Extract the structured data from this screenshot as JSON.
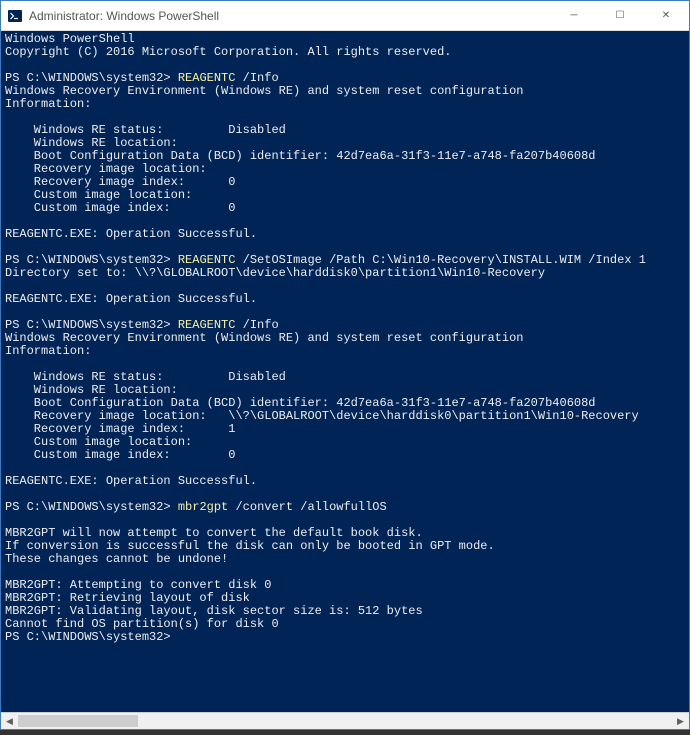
{
  "titlebar": {
    "title": "Administrator: Windows PowerShell",
    "icon_name": "powershell-icon"
  },
  "controls": {
    "minimize": "─",
    "maximize": "☐",
    "close": "✕"
  },
  "terminal": {
    "header1": "Windows PowerShell",
    "header2": "Copyright (C) 2016 Microsoft Corporation. All rights reserved.",
    "prompt": "PS C:\\WINDOWS\\system32>",
    "cmd1_exe": "REAGENTC",
    "cmd1_args": " /Info",
    "info_header": "Windows Recovery Environment (Windows RE) and system reset configuration",
    "info_label": "Information:",
    "re_status_lbl": "    Windows RE status:         ",
    "disabled": "Disabled",
    "re_location": "    Windows RE location:",
    "bcd_line": "    Boot Configuration Data (BCD) identifier: 42d7ea6a-31f3-11e7-a748-fa207b40608d",
    "rec_img_loc1": "    Recovery image location:",
    "rec_img_idx_lbl": "    Recovery image index:      ",
    "idx0": "0",
    "idx1": "1",
    "cust_img_loc": "    Custom image location:",
    "cust_img_idx_lbl": "    Custom image index:        ",
    "op_success": "REAGENTC.EXE: Operation Successful.",
    "cmd2_exe": "REAGENTC",
    "cmd2_args": " /SetOSImage /Path C:\\Win10-Recovery\\INSTALL.WIM /Index 1",
    "dir_set": "Directory set to: \\\\?\\GLOBALROOT\\device\\harddisk0\\partition1\\Win10-Recovery",
    "cmd3_exe": "REAGENTC",
    "cmd3_args": " /Info",
    "rec_img_loc2": "    Recovery image location:   \\\\?\\GLOBALROOT\\device\\harddisk0\\partition1\\Win10-Recovery",
    "cmd4_exe": "mbr2gpt",
    "cmd4_args": " /convert /allowfullOS",
    "mbr_msg1": "MBR2GPT will now attempt to convert the default book disk.",
    "mbr_msg2": "If conversion is successful the disk can only be booted in GPT mode.",
    "mbr_msg3": "These changes cannot be undone!",
    "mbr_attempt": "MBR2GPT: Attempting to convert disk 0",
    "mbr_retrieve": "MBR2GPT: Retrieving layout of disk",
    "mbr_validate": "MBR2GPT: Validating layout, disk sector size is: 512 bytes",
    "mbr_error": "Cannot find OS partition(s) for disk 0"
  }
}
